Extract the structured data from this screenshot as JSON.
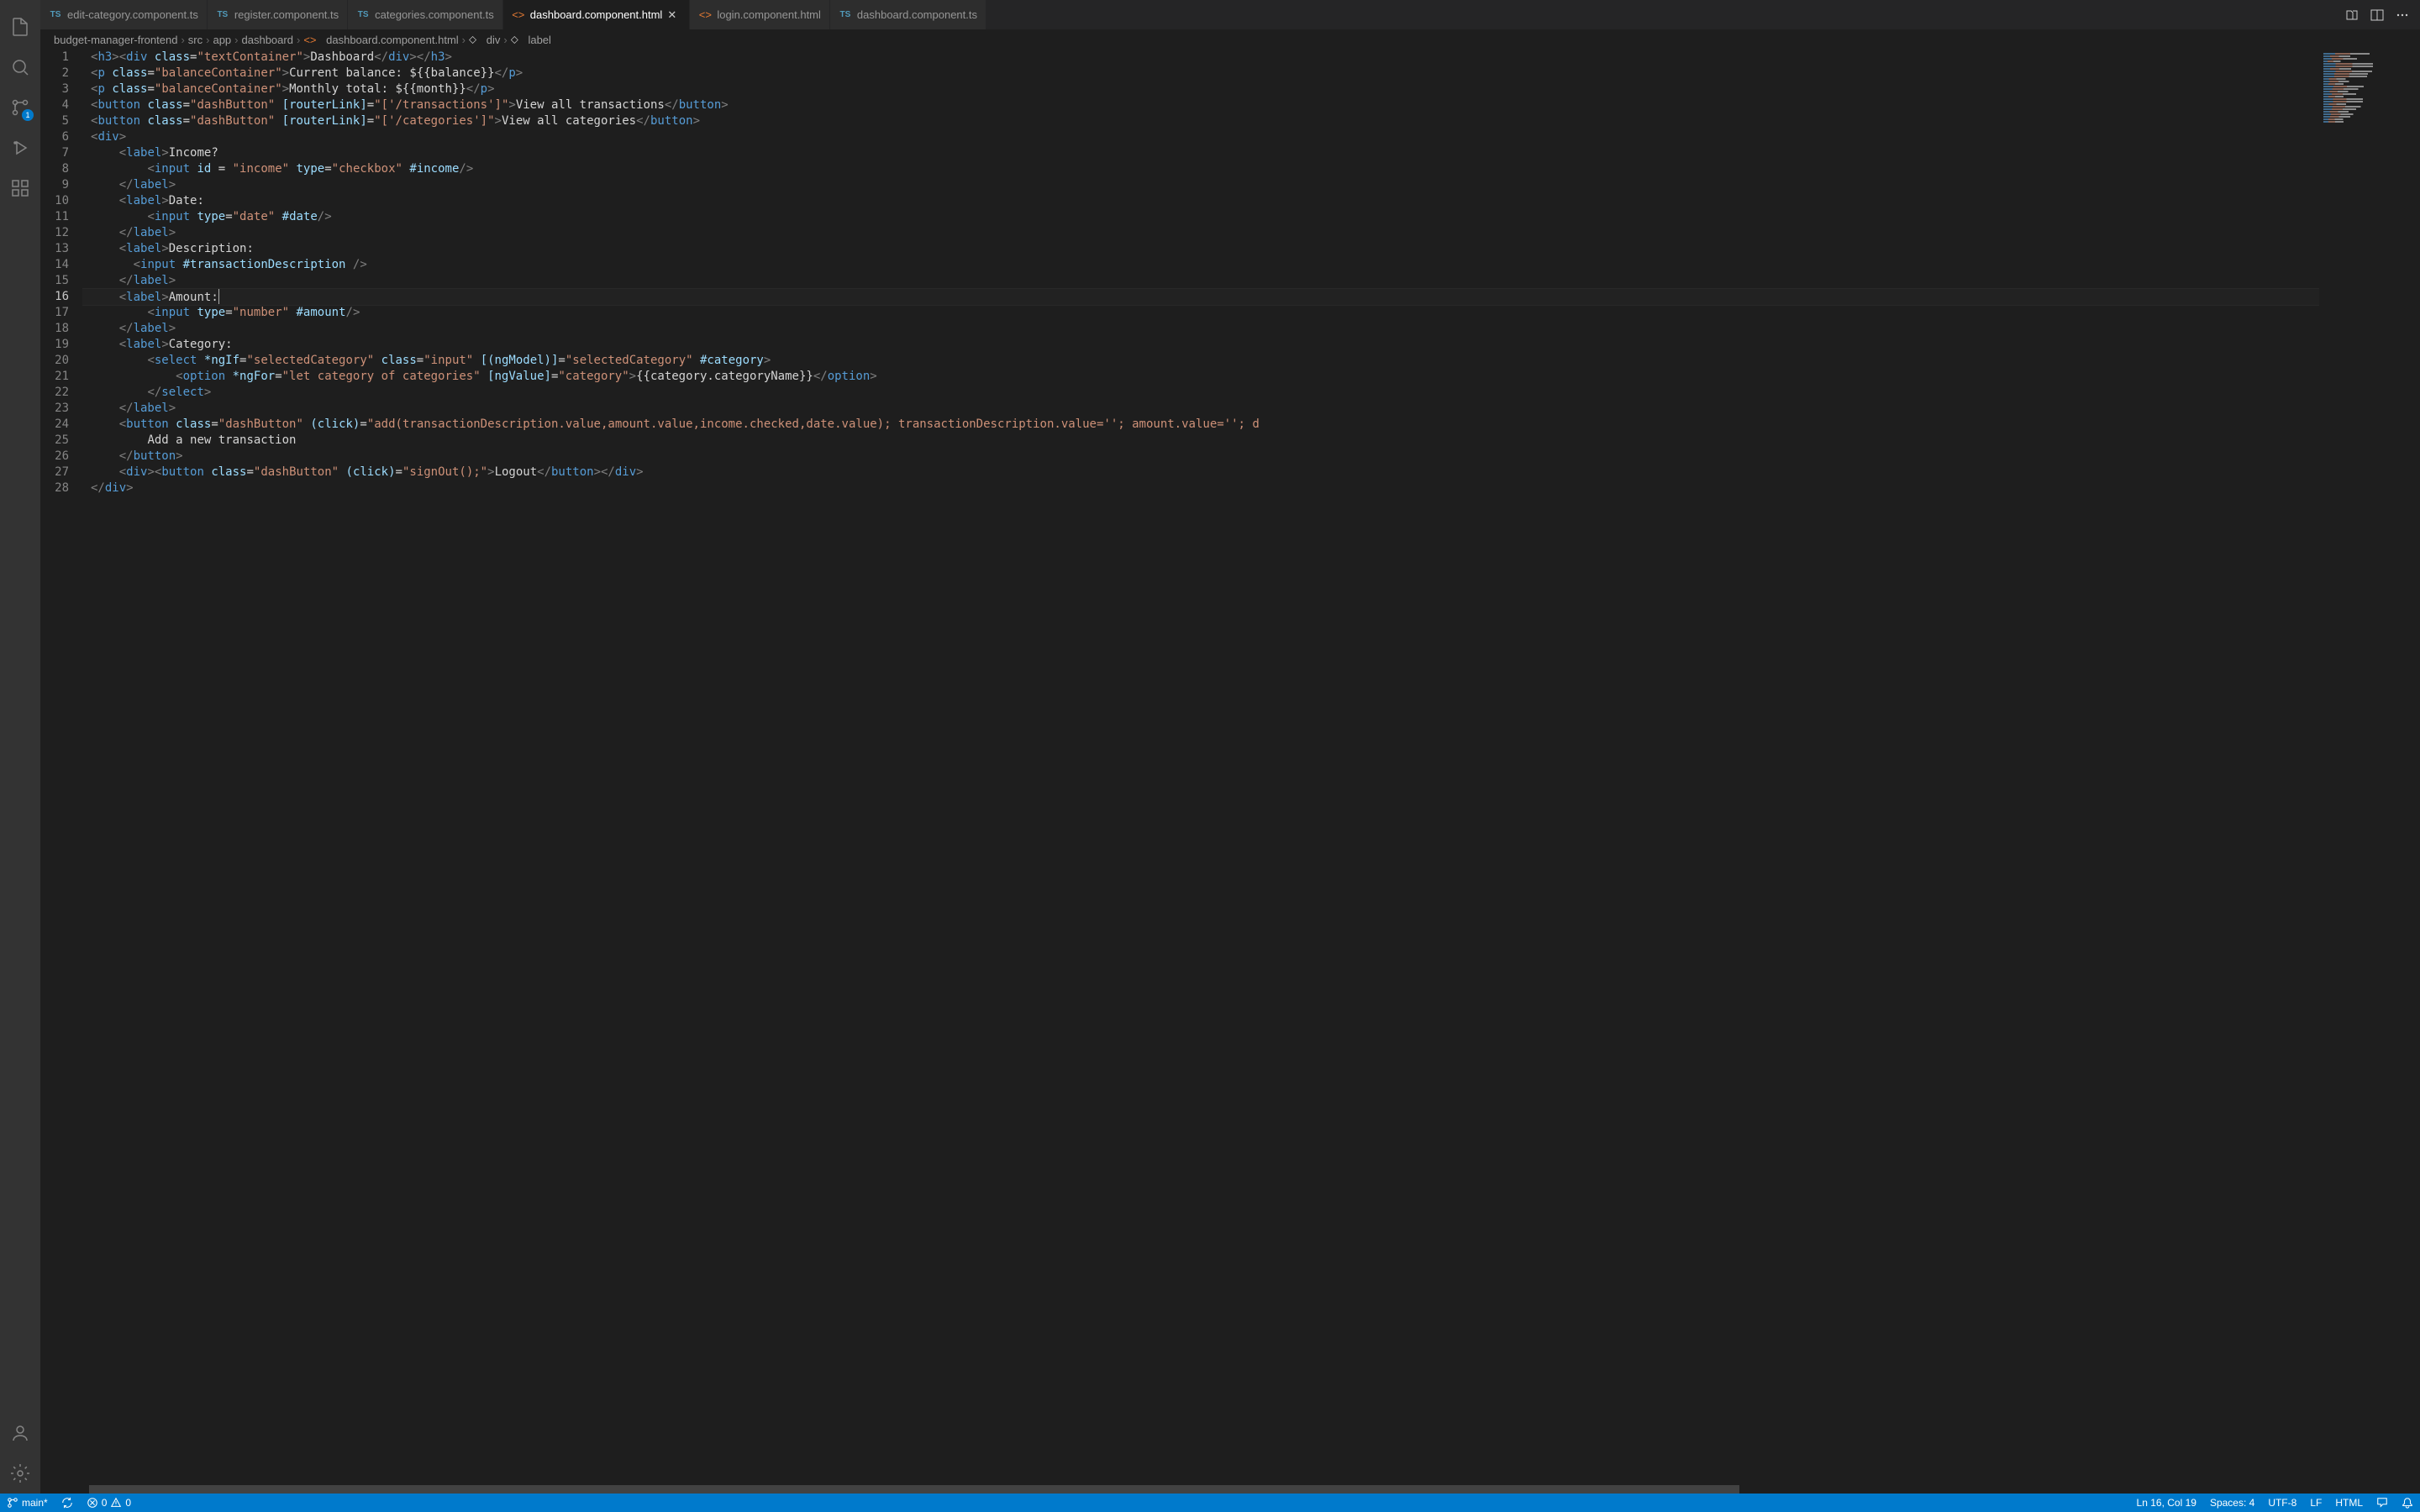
{
  "tabs": [
    {
      "icon": "ts",
      "label": "edit-category.component.ts",
      "active": false
    },
    {
      "icon": "ts",
      "label": "register.component.ts",
      "active": false
    },
    {
      "icon": "ts",
      "label": "categories.component.ts",
      "active": false
    },
    {
      "icon": "html",
      "label": "dashboard.component.html",
      "active": true
    },
    {
      "icon": "html",
      "label": "login.component.html",
      "active": false
    },
    {
      "icon": "ts",
      "label": "dashboard.component.ts",
      "active": false
    }
  ],
  "breadcrumbs": [
    "budget-manager-frontend",
    "src",
    "app",
    "dashboard",
    "dashboard.component.html",
    "div",
    "label"
  ],
  "breadcrumb_icons": [
    "",
    "",
    "",
    "",
    "html",
    "tag",
    "tag"
  ],
  "source_control_badge": "1",
  "line_numbers": [
    "1",
    "2",
    "3",
    "4",
    "5",
    "6",
    "7",
    "8",
    "9",
    "10",
    "11",
    "12",
    "13",
    "14",
    "15",
    "16",
    "17",
    "18",
    "19",
    "20",
    "21",
    "22",
    "23",
    "24",
    "25",
    "26",
    "27",
    "28"
  ],
  "current_line": 16,
  "statusbar": {
    "branch": "main*",
    "errors": "0",
    "warnings": "0",
    "cursor": "Ln 16, Col 19",
    "spaces": "Spaces: 4",
    "encoding": "UTF-8",
    "eol": "LF",
    "language": "HTML"
  },
  "code": {
    "l1": {
      "pre": "",
      "tokens": [
        [
          "<",
          "bracket"
        ],
        [
          "h3",
          "tag"
        ],
        [
          "><",
          "bracket"
        ],
        [
          "div",
          "tag"
        ],
        [
          " ",
          "text"
        ],
        [
          "class",
          "attr"
        ],
        [
          "=",
          "text"
        ],
        [
          "\"textContainer\"",
          "str"
        ],
        [
          ">",
          "bracket"
        ],
        [
          "Dashboard",
          "text"
        ],
        [
          "</",
          "bracket"
        ],
        [
          "div",
          "tag"
        ],
        [
          "></",
          "bracket"
        ],
        [
          "h3",
          "tag"
        ],
        [
          ">",
          "bracket"
        ]
      ]
    },
    "l2": {
      "pre": "",
      "tokens": [
        [
          "<",
          "bracket"
        ],
        [
          "p",
          "tag"
        ],
        [
          " ",
          "text"
        ],
        [
          "class",
          "attr"
        ],
        [
          "=",
          "text"
        ],
        [
          "\"balanceContainer\"",
          "str"
        ],
        [
          ">",
          "bracket"
        ],
        [
          "Current balance: ${{balance}}",
          "text"
        ],
        [
          "</",
          "bracket"
        ],
        [
          "p",
          "tag"
        ],
        [
          ">",
          "bracket"
        ]
      ]
    },
    "l3": {
      "pre": "",
      "tokens": [
        [
          "<",
          "bracket"
        ],
        [
          "p",
          "tag"
        ],
        [
          " ",
          "text"
        ],
        [
          "class",
          "attr"
        ],
        [
          "=",
          "text"
        ],
        [
          "\"balanceContainer\"",
          "str"
        ],
        [
          ">",
          "bracket"
        ],
        [
          "Monthly total: ${{month}}",
          "text"
        ],
        [
          "</",
          "bracket"
        ],
        [
          "p",
          "tag"
        ],
        [
          ">",
          "bracket"
        ]
      ]
    },
    "l4": {
      "pre": "",
      "tokens": [
        [
          "<",
          "bracket"
        ],
        [
          "button",
          "tag"
        ],
        [
          " ",
          "text"
        ],
        [
          "class",
          "attr"
        ],
        [
          "=",
          "text"
        ],
        [
          "\"dashButton\"",
          "str"
        ],
        [
          " ",
          "text"
        ],
        [
          "[routerLink]",
          "attr"
        ],
        [
          "=",
          "text"
        ],
        [
          "\"['/transactions']\"",
          "str"
        ],
        [
          ">",
          "bracket"
        ],
        [
          "View all transactions",
          "text"
        ],
        [
          "</",
          "bracket"
        ],
        [
          "button",
          "tag"
        ],
        [
          ">",
          "bracket"
        ]
      ]
    },
    "l5": {
      "pre": "",
      "tokens": [
        [
          "<",
          "bracket"
        ],
        [
          "button",
          "tag"
        ],
        [
          " ",
          "text"
        ],
        [
          "class",
          "attr"
        ],
        [
          "=",
          "text"
        ],
        [
          "\"dashButton\"",
          "str"
        ],
        [
          " ",
          "text"
        ],
        [
          "[routerLink]",
          "attr"
        ],
        [
          "=",
          "text"
        ],
        [
          "\"['/categories']\"",
          "str"
        ],
        [
          ">",
          "bracket"
        ],
        [
          "View all categories",
          "text"
        ],
        [
          "</",
          "bracket"
        ],
        [
          "button",
          "tag"
        ],
        [
          ">",
          "bracket"
        ]
      ]
    },
    "l6": {
      "pre": "",
      "tokens": [
        [
          "<",
          "bracket"
        ],
        [
          "div",
          "tag"
        ],
        [
          ">",
          "bracket"
        ]
      ]
    },
    "l7": {
      "pre": "    ",
      "guides": [
        1
      ],
      "tokens": [
        [
          "<",
          "bracket"
        ],
        [
          "label",
          "tag"
        ],
        [
          ">",
          "bracket"
        ],
        [
          "Income?",
          "text"
        ]
      ]
    },
    "l8": {
      "pre": "        ",
      "guides": [
        1,
        5
      ],
      "tokens": [
        [
          "<",
          "bracket"
        ],
        [
          "input",
          "tag"
        ],
        [
          " ",
          "text"
        ],
        [
          "id",
          "attr"
        ],
        [
          " = ",
          "text"
        ],
        [
          "\"income\"",
          "str"
        ],
        [
          " ",
          "text"
        ],
        [
          "type",
          "attr"
        ],
        [
          "=",
          "text"
        ],
        [
          "\"checkbox\"",
          "str"
        ],
        [
          " ",
          "text"
        ],
        [
          "#income",
          "attr"
        ],
        [
          "/>",
          "bracket"
        ]
      ]
    },
    "l9": {
      "pre": "    ",
      "guides": [
        1
      ],
      "tokens": [
        [
          "</",
          "bracket"
        ],
        [
          "label",
          "tag"
        ],
        [
          ">",
          "bracket"
        ]
      ]
    },
    "l10": {
      "pre": "    ",
      "guides": [
        1
      ],
      "tokens": [
        [
          "<",
          "bracket"
        ],
        [
          "label",
          "tag"
        ],
        [
          ">",
          "bracket"
        ],
        [
          "Date:",
          "text"
        ]
      ]
    },
    "l11": {
      "pre": "        ",
      "guides": [
        1,
        5
      ],
      "tokens": [
        [
          "<",
          "bracket"
        ],
        [
          "input",
          "tag"
        ],
        [
          " ",
          "text"
        ],
        [
          "type",
          "attr"
        ],
        [
          "=",
          "text"
        ],
        [
          "\"date\"",
          "str"
        ],
        [
          " ",
          "text"
        ],
        [
          "#date",
          "attr"
        ],
        [
          "/>",
          "bracket"
        ]
      ]
    },
    "l12": {
      "pre": "    ",
      "guides": [
        1
      ],
      "tokens": [
        [
          "</",
          "bracket"
        ],
        [
          "label",
          "tag"
        ],
        [
          ">",
          "bracket"
        ]
      ]
    },
    "l13": {
      "pre": "    ",
      "guides": [
        1
      ],
      "tokens": [
        [
          "<",
          "bracket"
        ],
        [
          "label",
          "tag"
        ],
        [
          ">",
          "bracket"
        ],
        [
          "Description:",
          "text"
        ]
      ]
    },
    "l14": {
      "pre": "      ",
      "guides": [
        1,
        5
      ],
      "tokens": [
        [
          "<",
          "bracket"
        ],
        [
          "input",
          "tag"
        ],
        [
          " ",
          "text"
        ],
        [
          "#transactionDescription",
          "attr"
        ],
        [
          " />",
          "bracket"
        ]
      ]
    },
    "l15": {
      "pre": "    ",
      "guides": [
        1
      ],
      "tokens": [
        [
          "</",
          "bracket"
        ],
        [
          "label",
          "tag"
        ],
        [
          ">",
          "bracket"
        ]
      ]
    },
    "l16": {
      "pre": "    ",
      "guides": [
        1
      ],
      "tokens": [
        [
          "<",
          "bracket"
        ],
        [
          "label",
          "tag"
        ],
        [
          ">",
          "bracket"
        ],
        [
          "Amount:",
          "text"
        ]
      ]
    },
    "l17": {
      "pre": "        ",
      "guides": [
        1,
        5
      ],
      "tokens": [
        [
          "<",
          "bracket"
        ],
        [
          "input",
          "tag"
        ],
        [
          " ",
          "text"
        ],
        [
          "type",
          "attr"
        ],
        [
          "=",
          "text"
        ],
        [
          "\"number\"",
          "str"
        ],
        [
          " ",
          "text"
        ],
        [
          "#amount",
          "attr"
        ],
        [
          "/>",
          "bracket"
        ]
      ]
    },
    "l18": {
      "pre": "    ",
      "guides": [
        1
      ],
      "tokens": [
        [
          "</",
          "bracket"
        ],
        [
          "label",
          "tag"
        ],
        [
          ">",
          "bracket"
        ]
      ]
    },
    "l19": {
      "pre": "    ",
      "guides": [
        1
      ],
      "tokens": [
        [
          "<",
          "bracket"
        ],
        [
          "label",
          "tag"
        ],
        [
          ">",
          "bracket"
        ],
        [
          "Category:",
          "text"
        ]
      ]
    },
    "l20": {
      "pre": "        ",
      "guides": [
        1,
        5
      ],
      "tokens": [
        [
          "<",
          "bracket"
        ],
        [
          "select",
          "tag"
        ],
        [
          " ",
          "text"
        ],
        [
          "*ngIf",
          "attr"
        ],
        [
          "=",
          "text"
        ],
        [
          "\"selectedCategory\"",
          "str"
        ],
        [
          " ",
          "text"
        ],
        [
          "class",
          "attr"
        ],
        [
          "=",
          "text"
        ],
        [
          "\"input\"",
          "str"
        ],
        [
          " ",
          "text"
        ],
        [
          "[(ngModel)]",
          "attr"
        ],
        [
          "=",
          "text"
        ],
        [
          "\"selectedCategory\"",
          "str"
        ],
        [
          " ",
          "text"
        ],
        [
          "#category",
          "attr"
        ],
        [
          ">",
          "bracket"
        ]
      ]
    },
    "l21": {
      "pre": "            ",
      "guides": [
        1,
        5,
        9
      ],
      "tokens": [
        [
          "<",
          "bracket"
        ],
        [
          "option",
          "tag"
        ],
        [
          " ",
          "text"
        ],
        [
          "*ngFor",
          "attr"
        ],
        [
          "=",
          "text"
        ],
        [
          "\"let category of categories\"",
          "str"
        ],
        [
          " ",
          "text"
        ],
        [
          "[ngValue]",
          "attr"
        ],
        [
          "=",
          "text"
        ],
        [
          "\"category\"",
          "str"
        ],
        [
          ">",
          "bracket"
        ],
        [
          "{{category.categoryName}}",
          "text"
        ],
        [
          "</",
          "bracket"
        ],
        [
          "option",
          "tag"
        ],
        [
          ">",
          "bracket"
        ]
      ]
    },
    "l22": {
      "pre": "        ",
      "guides": [
        1,
        5
      ],
      "tokens": [
        [
          "</",
          "bracket"
        ],
        [
          "select",
          "tag"
        ],
        [
          ">",
          "bracket"
        ]
      ]
    },
    "l23": {
      "pre": "    ",
      "guides": [
        1
      ],
      "tokens": [
        [
          "</",
          "bracket"
        ],
        [
          "label",
          "tag"
        ],
        [
          ">",
          "bracket"
        ]
      ]
    },
    "l24": {
      "pre": "    ",
      "guides": [
        1
      ],
      "tokens": [
        [
          "<",
          "bracket"
        ],
        [
          "button",
          "tag"
        ],
        [
          " ",
          "text"
        ],
        [
          "class",
          "attr"
        ],
        [
          "=",
          "text"
        ],
        [
          "\"dashButton\"",
          "str"
        ],
        [
          " ",
          "text"
        ],
        [
          "(click)",
          "attr"
        ],
        [
          "=",
          "text"
        ],
        [
          "\"add(transactionDescription.value,amount.value,income.checked,date.value); transactionDescription.value=''; amount.value=''; d",
          "str"
        ]
      ]
    },
    "l25": {
      "pre": "        ",
      "guides": [
        1,
        5
      ],
      "tokens": [
        [
          "Add a new transaction",
          "text"
        ]
      ]
    },
    "l26": {
      "pre": "    ",
      "guides": [
        1
      ],
      "tokens": [
        [
          "</",
          "bracket"
        ],
        [
          "button",
          "tag"
        ],
        [
          ">",
          "bracket"
        ]
      ]
    },
    "l27": {
      "pre": "    ",
      "guides": [
        1
      ],
      "tokens": [
        [
          "<",
          "bracket"
        ],
        [
          "div",
          "tag"
        ],
        [
          "><",
          "bracket"
        ],
        [
          "button",
          "tag"
        ],
        [
          " ",
          "text"
        ],
        [
          "class",
          "attr"
        ],
        [
          "=",
          "text"
        ],
        [
          "\"dashButton\"",
          "str"
        ],
        [
          " ",
          "text"
        ],
        [
          "(click)",
          "attr"
        ],
        [
          "=",
          "text"
        ],
        [
          "\"signOut();\"",
          "str"
        ],
        [
          ">",
          "bracket"
        ],
        [
          "Logout",
          "text"
        ],
        [
          "</",
          "bracket"
        ],
        [
          "button",
          "tag"
        ],
        [
          "></",
          "bracket"
        ],
        [
          "div",
          "tag"
        ],
        [
          ">",
          "bracket"
        ]
      ]
    },
    "l28": {
      "pre": "",
      "tokens": [
        [
          "</",
          "bracket"
        ],
        [
          "div",
          "tag"
        ],
        [
          ">",
          "bracket"
        ]
      ]
    }
  }
}
